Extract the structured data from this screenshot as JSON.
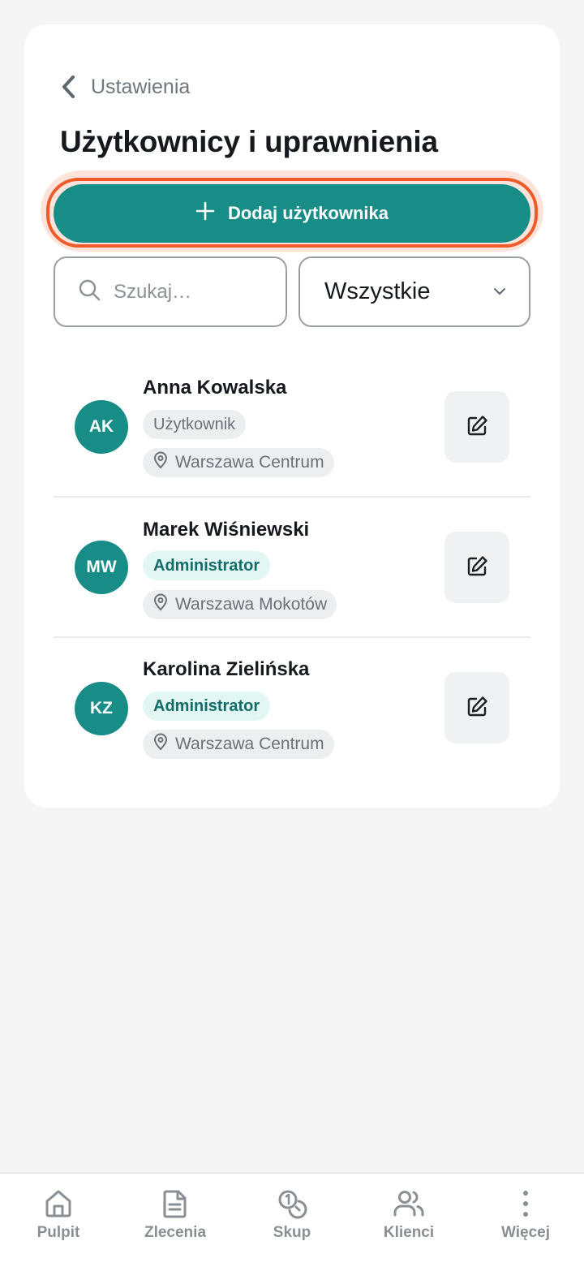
{
  "header": {
    "back_label": "Ustawienia",
    "title": "Użytkownicy i uprawnienia"
  },
  "actions": {
    "add_user_label": "Dodaj użytkownika"
  },
  "search": {
    "placeholder": "Szukaj…",
    "value": ""
  },
  "filter": {
    "selected": "Wszystkie"
  },
  "users": [
    {
      "initials": "AK",
      "name": "Anna Kowalska",
      "role": "Użytkownik",
      "location": "Warszawa Centrum"
    },
    {
      "initials": "MW",
      "name": "Marek Wiśniewski",
      "role": "Administrator",
      "location": "Warszawa Mokotów"
    },
    {
      "initials": "KZ",
      "name": "Karolina Zielińska",
      "role": "Administrator",
      "location": "Warszawa Centrum"
    }
  ],
  "bottom_nav": [
    {
      "label": "Pulpit",
      "icon": "home-icon"
    },
    {
      "label": "Zlecenia",
      "icon": "document-icon"
    },
    {
      "label": "Skup",
      "icon": "coins-icon"
    },
    {
      "label": "Klienci",
      "icon": "users-icon"
    },
    {
      "label": "Więcej",
      "icon": "more-vertical-icon"
    }
  ],
  "colors": {
    "accent": "#188d87",
    "highlight": "#ef5a2b",
    "admin_badge_bg": "#e2f6f4",
    "admin_badge_text": "#116d68"
  }
}
